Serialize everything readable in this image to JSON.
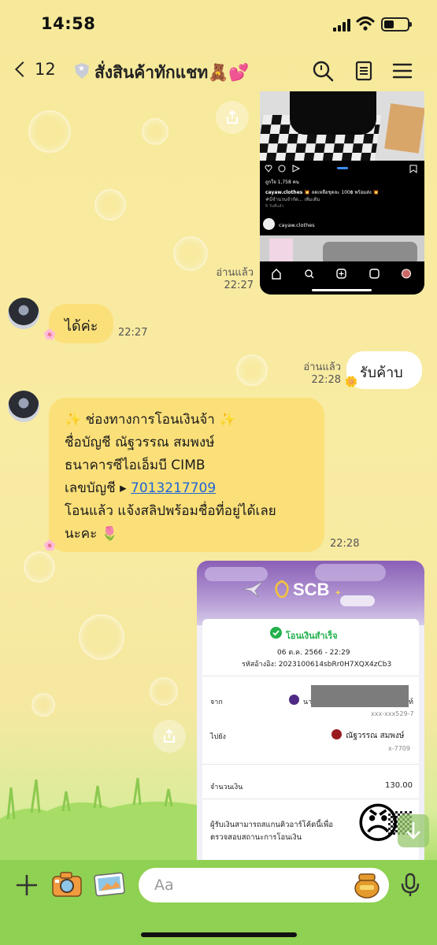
{
  "status_bar": {
    "time": "14:58",
    "battery_level": 0.3
  },
  "header": {
    "back_count": "12",
    "title": "สั่งสินค้าทักแชท🧸💕"
  },
  "messages": {
    "ig_read": "อ่านแล้ว",
    "ig_time": "22:27",
    "ig_post": {
      "likes": "ถูกใจ 1,758 คน",
      "caption_user": "cayaw.clothes",
      "caption": "💥 ลดเหลือชุดละ 100฿ พร้อมส่ง 💥",
      "caption_more": "#มีจำนวนจำกัด... เพิ่มเติม",
      "posted": "6 วันที่แล้ว",
      "account": "cayaw.clothes"
    },
    "m1_text": "ได้ค่ะ",
    "m1_time": "22:27",
    "m2_read": "อ่านแล้ว",
    "m2_time": "22:28",
    "m2_text": "รับค้าบ",
    "m3": {
      "line1": "✨  ช่องทางการโอนเงินจ้า ✨",
      "line2": "ชื่อบัญชี ณัฐวรรณ สมพงษ์",
      "line3": "ธนาคารซีไอเอ็มบี CIMB",
      "line4_prefix": "เลขบัญชี ▸ ",
      "line4_link": "7013217709",
      "line5": "โอนแล้ว  แจ้งสลิปพร้อมชื่อที่อยู่ได้เลย",
      "line6": "นะคะ 🌷",
      "time": "22:28"
    }
  },
  "receipt": {
    "bank": "SCB",
    "status": "โอนเงินสำเร็จ",
    "datetime": "06 ต.ค. 2566 - 22:29",
    "ref": "รหัสอ้างอิง: 2023100614sbRr0H7XQX4zCb3",
    "from_label": "จาก",
    "from_name": "นา",
    "from_tail": "ท์",
    "from_acct": "xxx-xxx529-7",
    "to_label": "ไปยัง",
    "to_name": "ณัฐวรรณ สมพงษ์",
    "to_acct": "x-7709",
    "amount_label": "จำนวนเงิน",
    "amount": "130.00",
    "qr_note_1": "ผู้รับเงินสามารถสแกนคิวอาร์โค้ดนี้เพื่อ",
    "qr_note_2": "ตรวจสอบสถานะการโอนเงิน"
  },
  "input": {
    "placeholder": "Aa"
  },
  "sticker": "😠",
  "colors": {
    "bubble_in": "#fbe07a",
    "bubble_out": "#ffffff",
    "bottom_bar": "#8fd152",
    "link": "#1d64d6",
    "scb_purple": "#4e2a84",
    "success": "#22b14c"
  }
}
